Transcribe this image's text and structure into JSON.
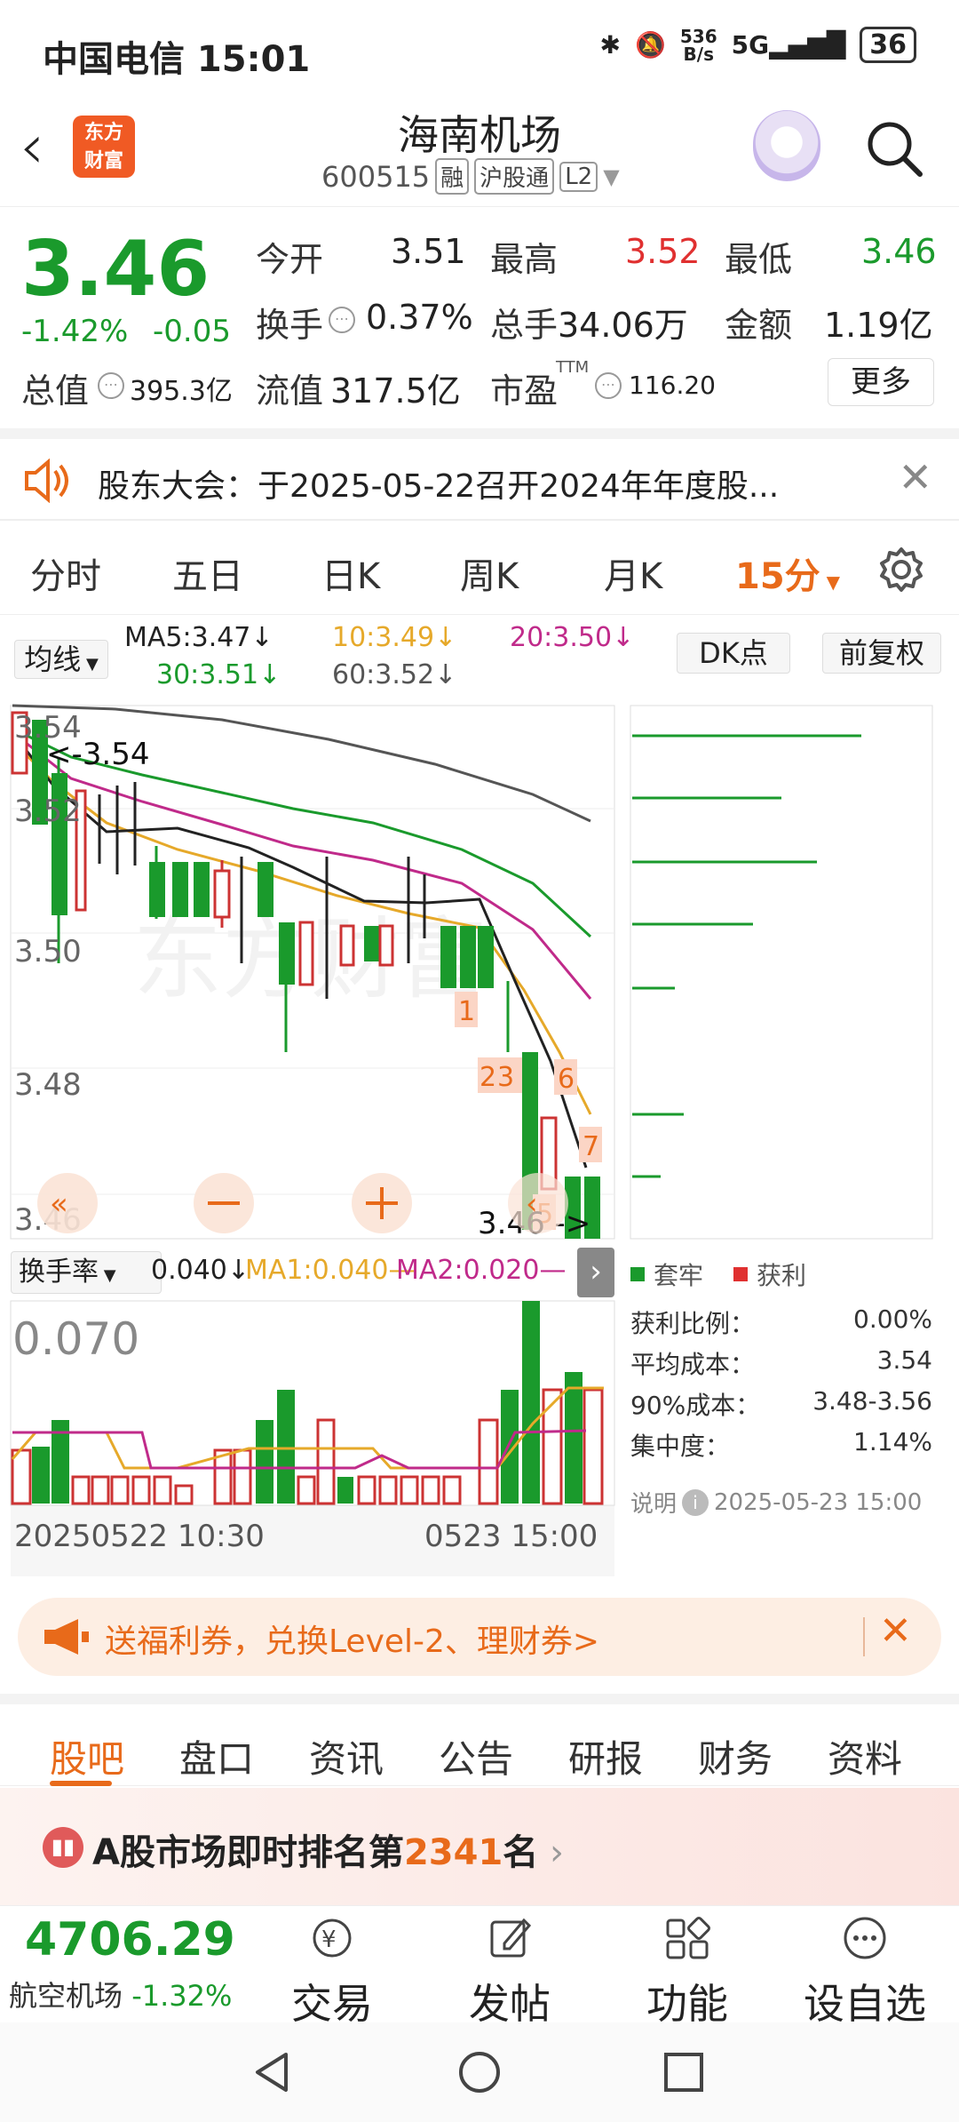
{
  "status": {
    "carrier_time": "中国电信 15:01",
    "net_speed": "536\nB/s",
    "net_speed_top": "536",
    "net_speed_bottom": "B/s",
    "net": "5G",
    "battery": "36"
  },
  "header": {
    "stock_name": "海南机场",
    "stock_code": "600515",
    "tags": [
      "融",
      "沪股通",
      "L2"
    ],
    "logo_top": "东方",
    "logo_bottom": "财富"
  },
  "quote": {
    "price": "3.46",
    "change_pct": "-1.42%",
    "change": "-0.05",
    "open_label": "今开",
    "open": "3.51",
    "high_label": "最高",
    "high": "3.52",
    "low_label": "最低",
    "low": "3.46",
    "turnover_label": "换手",
    "turnover": "0.37%",
    "volume_label": "总手",
    "volume": "34.06万",
    "amount_label": "金额",
    "amount": "1.19亿",
    "mktcap_label": "总值",
    "mktcap": "395.3亿",
    "float_label": "流值",
    "float": "317.5亿",
    "pe_label": "市盈",
    "pe_sup": "TTM",
    "pe": "116.20",
    "more": "更多"
  },
  "notice": {
    "text": "股东大会：于2025-05-22召开2024年年度股..."
  },
  "chart_tabs": [
    "分时",
    "五日",
    "日K",
    "周K",
    "月K",
    "15分"
  ],
  "ma": {
    "button": "均线",
    "ma5": "MA5:3.47↓",
    "ma10": "10:3.49↓",
    "ma20": "20:3.50↓",
    "ma30": "30:3.51↓",
    "ma60": "60:3.52↓",
    "dk": "DK点",
    "fq": "前复权"
  },
  "price_axis": [
    "3.54",
    "3.52",
    "3.50",
    "3.48",
    "3.46"
  ],
  "marker_high": "<-3.54",
  "marker_low": "3.46 ->",
  "signals": [
    "1",
    "2",
    "3",
    "6",
    "7",
    "5"
  ],
  "vol": {
    "button": "换手率",
    "value": "0.040↓",
    "ma1": "MA1:0.040—",
    "ma2": "MA2:0.020—",
    "axis_top": "0.070"
  },
  "time_axis": {
    "left": "20250522 10:30",
    "mid": "0523 15:00"
  },
  "chips": {
    "legend_a": "套牢",
    "legend_b": "获利",
    "rows": [
      {
        "label": "获利比例：",
        "value": "0.00%"
      },
      {
        "label": "平均成本：",
        "value": "3.54"
      },
      {
        "label": "90%成本：",
        "value": "3.48-3.56"
      },
      {
        "label": "集中度：",
        "value": "1.14%"
      }
    ],
    "note": "说明",
    "note_time": "2025-05-23 15:00"
  },
  "ad": {
    "text": "送福利券，兑换Level-2、理财券>"
  },
  "bottom_tabs": [
    "股吧",
    "盘口",
    "资讯",
    "公告",
    "研报",
    "财务",
    "资料"
  ],
  "rank": {
    "prefix": "A股市场即时排名第",
    "num": "2341",
    "suffix": "名"
  },
  "index": {
    "value": "4706.29",
    "name": "航空机场",
    "pct": "-1.32%"
  },
  "nav": [
    "交易",
    "发帖",
    "功能",
    "设自选"
  ],
  "colors": {
    "green": "#1a9a2c",
    "red": "#e03030",
    "orange": "#e86a1a"
  }
}
